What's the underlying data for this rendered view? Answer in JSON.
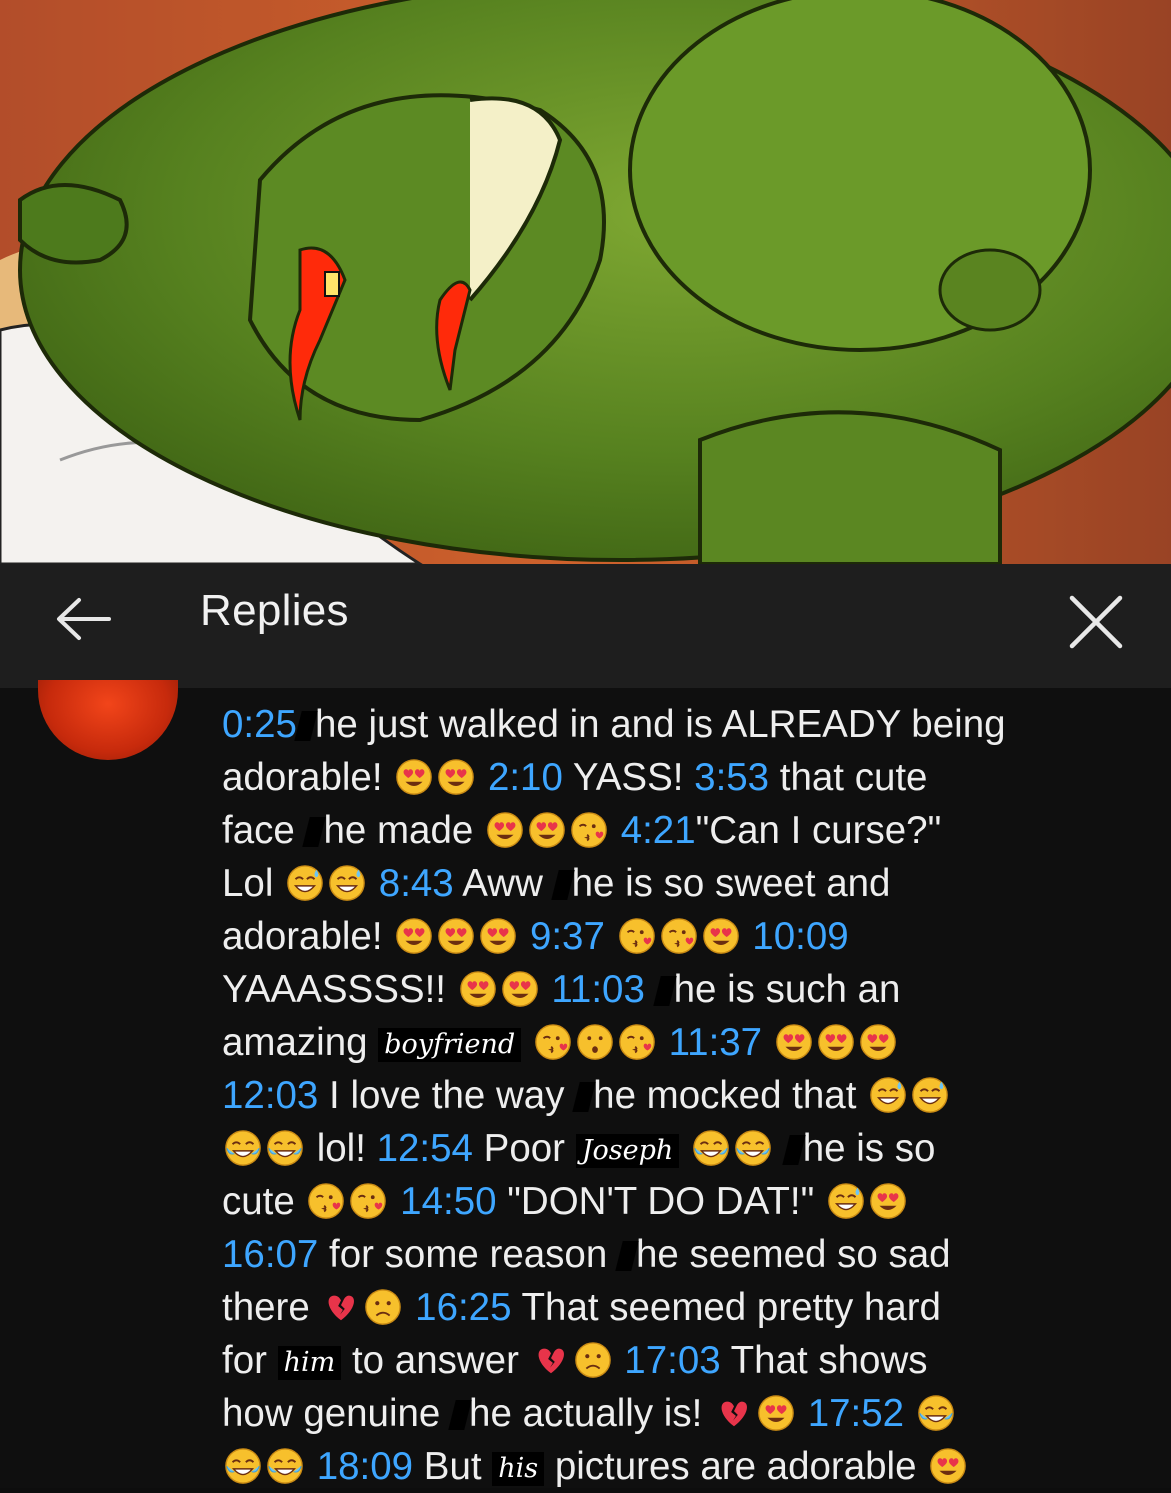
{
  "header": {
    "title": "Replies"
  },
  "comment": {
    "lines": [
      [
        {
          "t": "ts",
          "v": "0:25"
        },
        {
          "t": "redact"
        },
        {
          "t": "text",
          "v": "he just walked in and is ALREADY being"
        }
      ],
      [
        {
          "t": "text",
          "v": "adorable! "
        },
        {
          "t": "emoji",
          "v": "heart-eyes-emoji"
        },
        {
          "t": "emoji",
          "v": "heart-eyes-emoji"
        },
        {
          "t": "text",
          "v": " "
        },
        {
          "t": "ts",
          "v": "2:10"
        },
        {
          "t": "text",
          "v": " YASS! "
        },
        {
          "t": "ts",
          "v": "3:53"
        },
        {
          "t": "text",
          "v": " that cute"
        }
      ],
      [
        {
          "t": "text",
          "v": "face "
        },
        {
          "t": "redact"
        },
        {
          "t": "text",
          "v": "he made "
        },
        {
          "t": "emoji",
          "v": "heart-eyes-emoji"
        },
        {
          "t": "emoji",
          "v": "heart-eyes-emoji"
        },
        {
          "t": "emoji",
          "v": "kissing-heart-emoji"
        },
        {
          "t": "text",
          "v": " "
        },
        {
          "t": "ts",
          "v": "4:21"
        },
        {
          "t": "text",
          "v": "\"Can I curse?\""
        }
      ],
      [
        {
          "t": "text",
          "v": "Lol "
        },
        {
          "t": "emoji",
          "v": "sweat-smile-emoji"
        },
        {
          "t": "emoji",
          "v": "sweat-smile-emoji"
        },
        {
          "t": "text",
          "v": " "
        },
        {
          "t": "ts",
          "v": "8:43"
        },
        {
          "t": "text",
          "v": " Aww "
        },
        {
          "t": "redact"
        },
        {
          "t": "text",
          "v": "he is so sweet and"
        }
      ],
      [
        {
          "t": "text",
          "v": "adorable! "
        },
        {
          "t": "emoji",
          "v": "heart-eyes-emoji"
        },
        {
          "t": "emoji",
          "v": "heart-eyes-emoji"
        },
        {
          "t": "emoji",
          "v": "heart-eyes-emoji"
        },
        {
          "t": "text",
          "v": " "
        },
        {
          "t": "ts",
          "v": "9:37"
        },
        {
          "t": "text",
          "v": " "
        },
        {
          "t": "emoji",
          "v": "kissing-heart-emoji"
        },
        {
          "t": "emoji",
          "v": "kissing-heart-emoji"
        },
        {
          "t": "emoji",
          "v": "heart-eyes-emoji"
        },
        {
          "t": "text",
          "v": " "
        },
        {
          "t": "ts",
          "v": "10:09"
        }
      ],
      [
        {
          "t": "text",
          "v": "YAAASSSS!! "
        },
        {
          "t": "emoji",
          "v": "heart-eyes-emoji"
        },
        {
          "t": "emoji",
          "v": "heart-eyes-emoji"
        },
        {
          "t": "text",
          "v": " "
        },
        {
          "t": "ts",
          "v": "11:03"
        },
        {
          "t": "text",
          "v": " "
        },
        {
          "t": "redact"
        },
        {
          "t": "text",
          "v": "he is such an"
        }
      ],
      [
        {
          "t": "text",
          "v": "amazing "
        },
        {
          "t": "name",
          "v": "boyfriend"
        },
        {
          "t": "text",
          "v": " "
        },
        {
          "t": "emoji",
          "v": "kissing-heart-emoji"
        },
        {
          "t": "emoji",
          "v": "kissing-emoji"
        },
        {
          "t": "emoji",
          "v": "kissing-heart-emoji"
        },
        {
          "t": "text",
          "v": " "
        },
        {
          "t": "ts",
          "v": "11:37"
        },
        {
          "t": "text",
          "v": " "
        },
        {
          "t": "emoji",
          "v": "heart-eyes-emoji"
        },
        {
          "t": "emoji",
          "v": "heart-eyes-emoji"
        },
        {
          "t": "emoji",
          "v": "heart-eyes-emoji"
        }
      ],
      [
        {
          "t": "ts",
          "v": "12:03"
        },
        {
          "t": "text",
          "v": " I love the way "
        },
        {
          "t": "redact"
        },
        {
          "t": "text",
          "v": "he mocked that "
        },
        {
          "t": "emoji",
          "v": "sweat-smile-emoji"
        },
        {
          "t": "emoji",
          "v": "sweat-smile-emoji"
        }
      ],
      [
        {
          "t": "emoji",
          "v": "joy-emoji"
        },
        {
          "t": "emoji",
          "v": "joy-emoji"
        },
        {
          "t": "text",
          "v": " lol! "
        },
        {
          "t": "ts",
          "v": "12:54"
        },
        {
          "t": "text",
          "v": " Poor "
        },
        {
          "t": "name",
          "v": "Joseph"
        },
        {
          "t": "text",
          "v": " "
        },
        {
          "t": "emoji",
          "v": "joy-emoji"
        },
        {
          "t": "emoji",
          "v": "joy-emoji"
        },
        {
          "t": "text",
          "v": " "
        },
        {
          "t": "redact"
        },
        {
          "t": "text",
          "v": "he is so"
        }
      ],
      [
        {
          "t": "text",
          "v": "cute "
        },
        {
          "t": "emoji",
          "v": "kissing-heart-emoji"
        },
        {
          "t": "emoji",
          "v": "kissing-heart-emoji"
        },
        {
          "t": "text",
          "v": " "
        },
        {
          "t": "ts",
          "v": "14:50"
        },
        {
          "t": "text",
          "v": " \"DON'T DO DAT!\" "
        },
        {
          "t": "emoji",
          "v": "sweat-smile-emoji"
        },
        {
          "t": "emoji",
          "v": "heart-eyes-emoji"
        }
      ],
      [
        {
          "t": "ts",
          "v": "16:07"
        },
        {
          "t": "text",
          "v": " for some reason "
        },
        {
          "t": "redact"
        },
        {
          "t": "text",
          "v": "he seemed so sad"
        }
      ],
      [
        {
          "t": "text",
          "v": "there "
        },
        {
          "t": "emoji",
          "v": "broken-heart-emoji"
        },
        {
          "t": "emoji",
          "v": "slightly-frowning-emoji"
        },
        {
          "t": "text",
          "v": " "
        },
        {
          "t": "ts",
          "v": "16:25"
        },
        {
          "t": "text",
          "v": " That seemed pretty hard"
        }
      ],
      [
        {
          "t": "text",
          "v": "for "
        },
        {
          "t": "name",
          "v": "him"
        },
        {
          "t": "text",
          "v": " to answer "
        },
        {
          "t": "emoji",
          "v": "broken-heart-emoji"
        },
        {
          "t": "emoji",
          "v": "slightly-frowning-emoji"
        },
        {
          "t": "text",
          "v": " "
        },
        {
          "t": "ts",
          "v": "17:03"
        },
        {
          "t": "text",
          "v": " That shows"
        }
      ],
      [
        {
          "t": "text",
          "v": "how genuine "
        },
        {
          "t": "redact"
        },
        {
          "t": "text",
          "v": "he actually is! "
        },
        {
          "t": "emoji",
          "v": "broken-heart-emoji"
        },
        {
          "t": "emoji",
          "v": "heart-eyes-emoji"
        },
        {
          "t": "text",
          "v": " "
        },
        {
          "t": "ts",
          "v": "17:52"
        },
        {
          "t": "text",
          "v": " "
        },
        {
          "t": "emoji",
          "v": "joy-emoji"
        }
      ],
      [
        {
          "t": "emoji",
          "v": "joy-emoji"
        },
        {
          "t": "emoji",
          "v": "joy-emoji"
        },
        {
          "t": "text",
          "v": " "
        },
        {
          "t": "ts",
          "v": "18:09"
        },
        {
          "t": "text",
          "v": " But "
        },
        {
          "t": "name",
          "v": "his"
        },
        {
          "t": "text",
          "v": " pictures are adorable "
        },
        {
          "t": "emoji",
          "v": "heart-eyes-emoji"
        }
      ]
    ]
  },
  "colors": {
    "timestamp": "#3ea6ff",
    "text": "#eeeeee",
    "header_bg": "#1e1e1e",
    "content_bg": "#0f0f0f",
    "avatar": "#d7330f"
  }
}
